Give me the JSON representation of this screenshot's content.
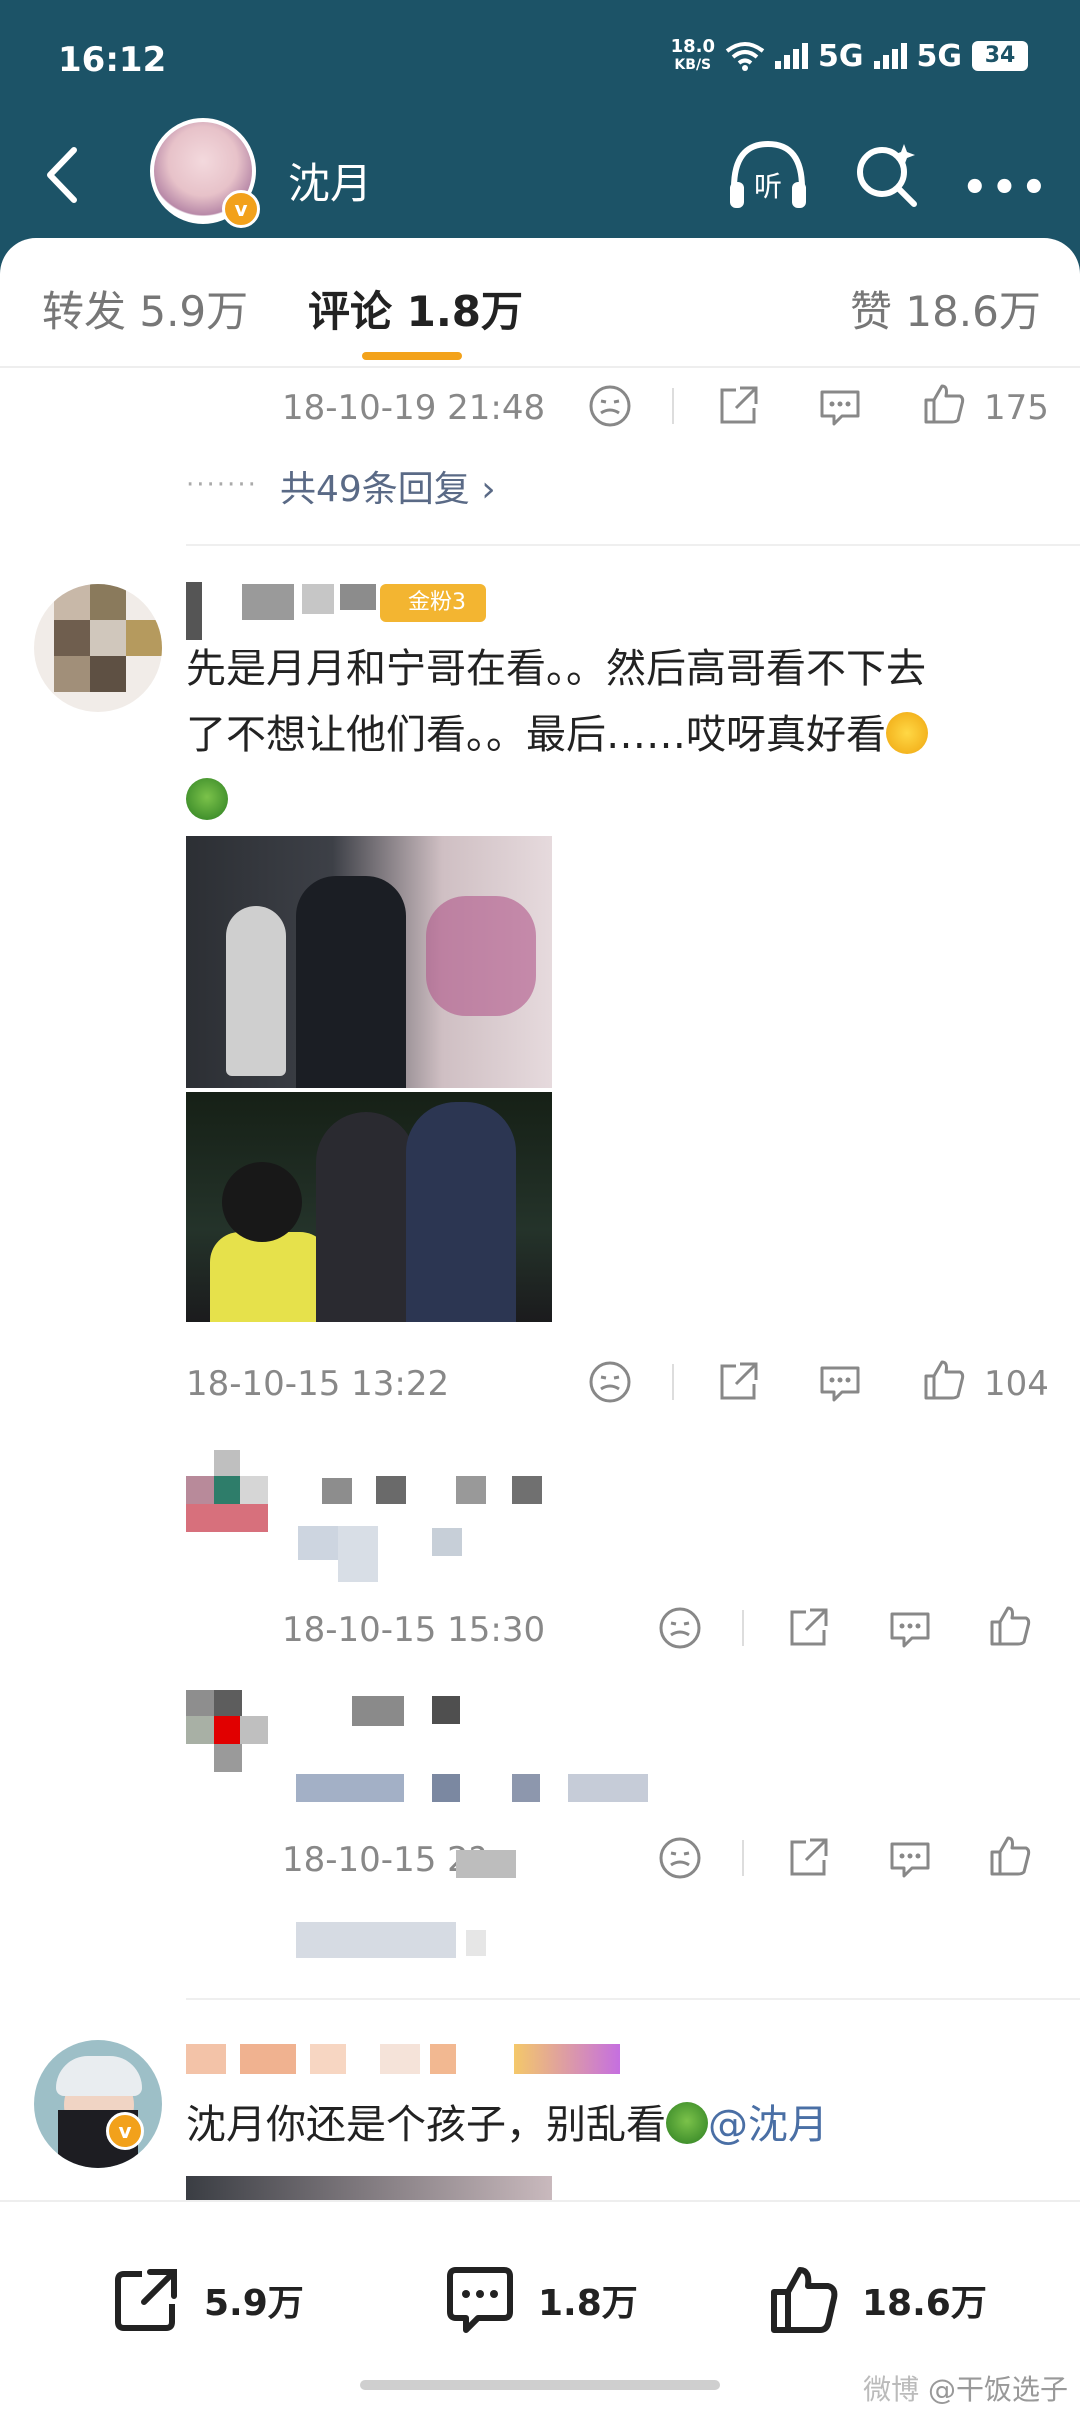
{
  "status_bar": {
    "time": "16:12",
    "net_speed_value": "18.0",
    "net_speed_unit": "KB/S",
    "network_1": "5G",
    "network_2": "5G",
    "battery": "34"
  },
  "nav": {
    "title": "沈月",
    "verified_mark": "v",
    "listen_label": "听"
  },
  "tabs": [
    {
      "label": "转发 5.9万"
    },
    {
      "label": "评论 1.8万"
    },
    {
      "label": "赞 18.6万"
    }
  ],
  "accent_color": "#f3a21a",
  "header_color": "#1c5367",
  "top_reply_footer": {
    "timestamp": "18-10-19 21:48",
    "likes": "175",
    "replies_link": "共49条回复",
    "replies_arrow": "›"
  },
  "comment_1": {
    "fan_badge": "金粉3",
    "text_line_1": "先是月月和宁哥在看。。然后高哥看不下去",
    "text_line_2": "了不想让他们看。。最后……哎呀真好看",
    "timestamp": "18-10-15 13:22",
    "likes": "104",
    "reply_1_timestamp": "18-10-15 15:30",
    "reply_2_timestamp": "18-10-15 2?"
  },
  "comment_2": {
    "text": "沈月你还是个孩子，别乱看",
    "mention": "@沈月"
  },
  "bottom_bar": {
    "repost_count": "5.9万",
    "comment_count": "1.8万",
    "like_count": "18.6万"
  },
  "watermark": "@干饭选子",
  "watermark_logo": "微博"
}
